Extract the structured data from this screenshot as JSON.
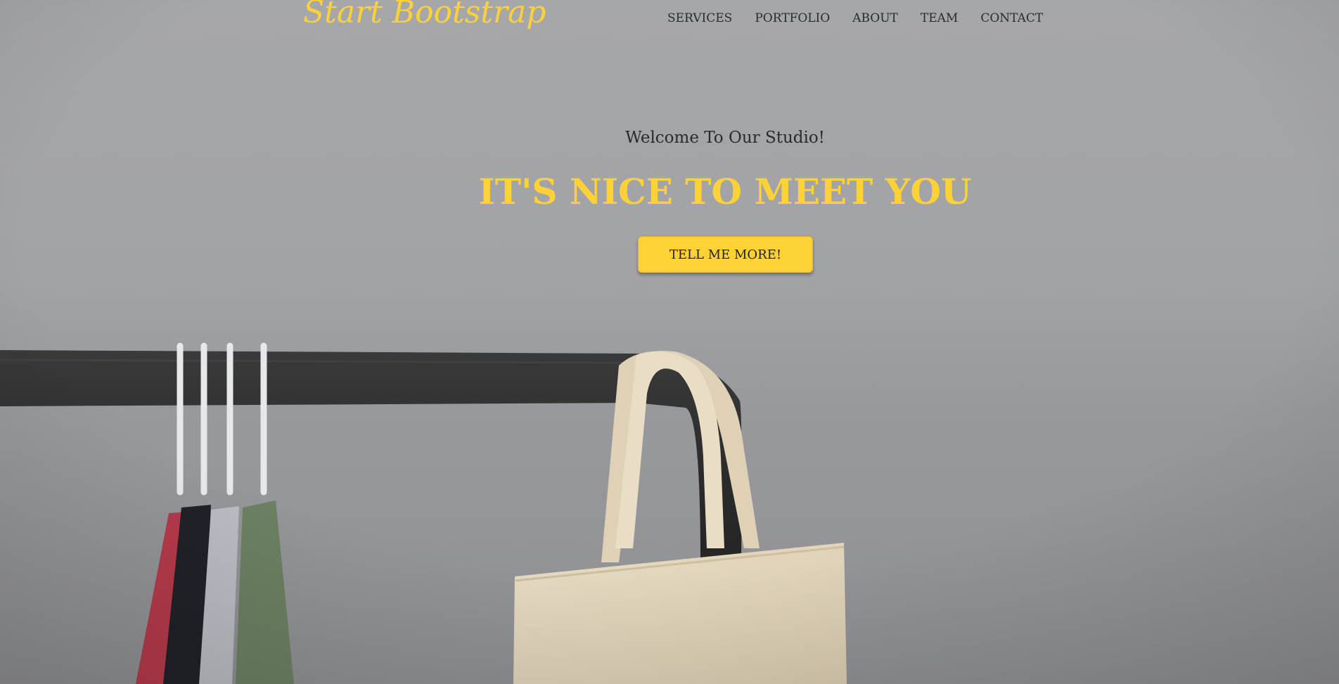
{
  "navbar": {
    "brand": "Start Bootstrap",
    "links": [
      "SERVICES",
      "PORTFOLIO",
      "ABOUT",
      "TEAM",
      "CONTACT"
    ]
  },
  "hero": {
    "lead": "Welcome To Our Studio!",
    "heading": "IT'S NICE TO MEET YOU",
    "button_label": "TELL ME MORE!",
    "background_image": "clothing-rack-photo"
  },
  "colors": {
    "accent": "#fed136",
    "background": "#a4a5a9",
    "text_dark": "#2b2b2b"
  }
}
